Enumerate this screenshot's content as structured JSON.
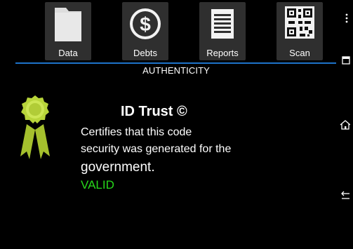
{
  "toolbar": {
    "tabs": [
      {
        "label": "Data",
        "icon": "folder-icon"
      },
      {
        "label": "Debts",
        "icon": "dollar-icon"
      },
      {
        "label": "Reports",
        "icon": "report-icon"
      },
      {
        "label": "Scan",
        "icon": "qr-code-icon"
      }
    ]
  },
  "page": {
    "section_title": "AUTHENTICITY"
  },
  "certificate": {
    "title": "ID Trust ©",
    "line1": "Certifies that this code",
    "line2": "security was generated for the",
    "line3": "government.",
    "status": "VALID"
  },
  "colors": {
    "accent": "#1e73c9",
    "status_valid": "#27d81b",
    "badge": "#b8d53a"
  },
  "system_nav": [
    "more-icon",
    "recent-apps-icon",
    "home-icon",
    "back-icon"
  ]
}
